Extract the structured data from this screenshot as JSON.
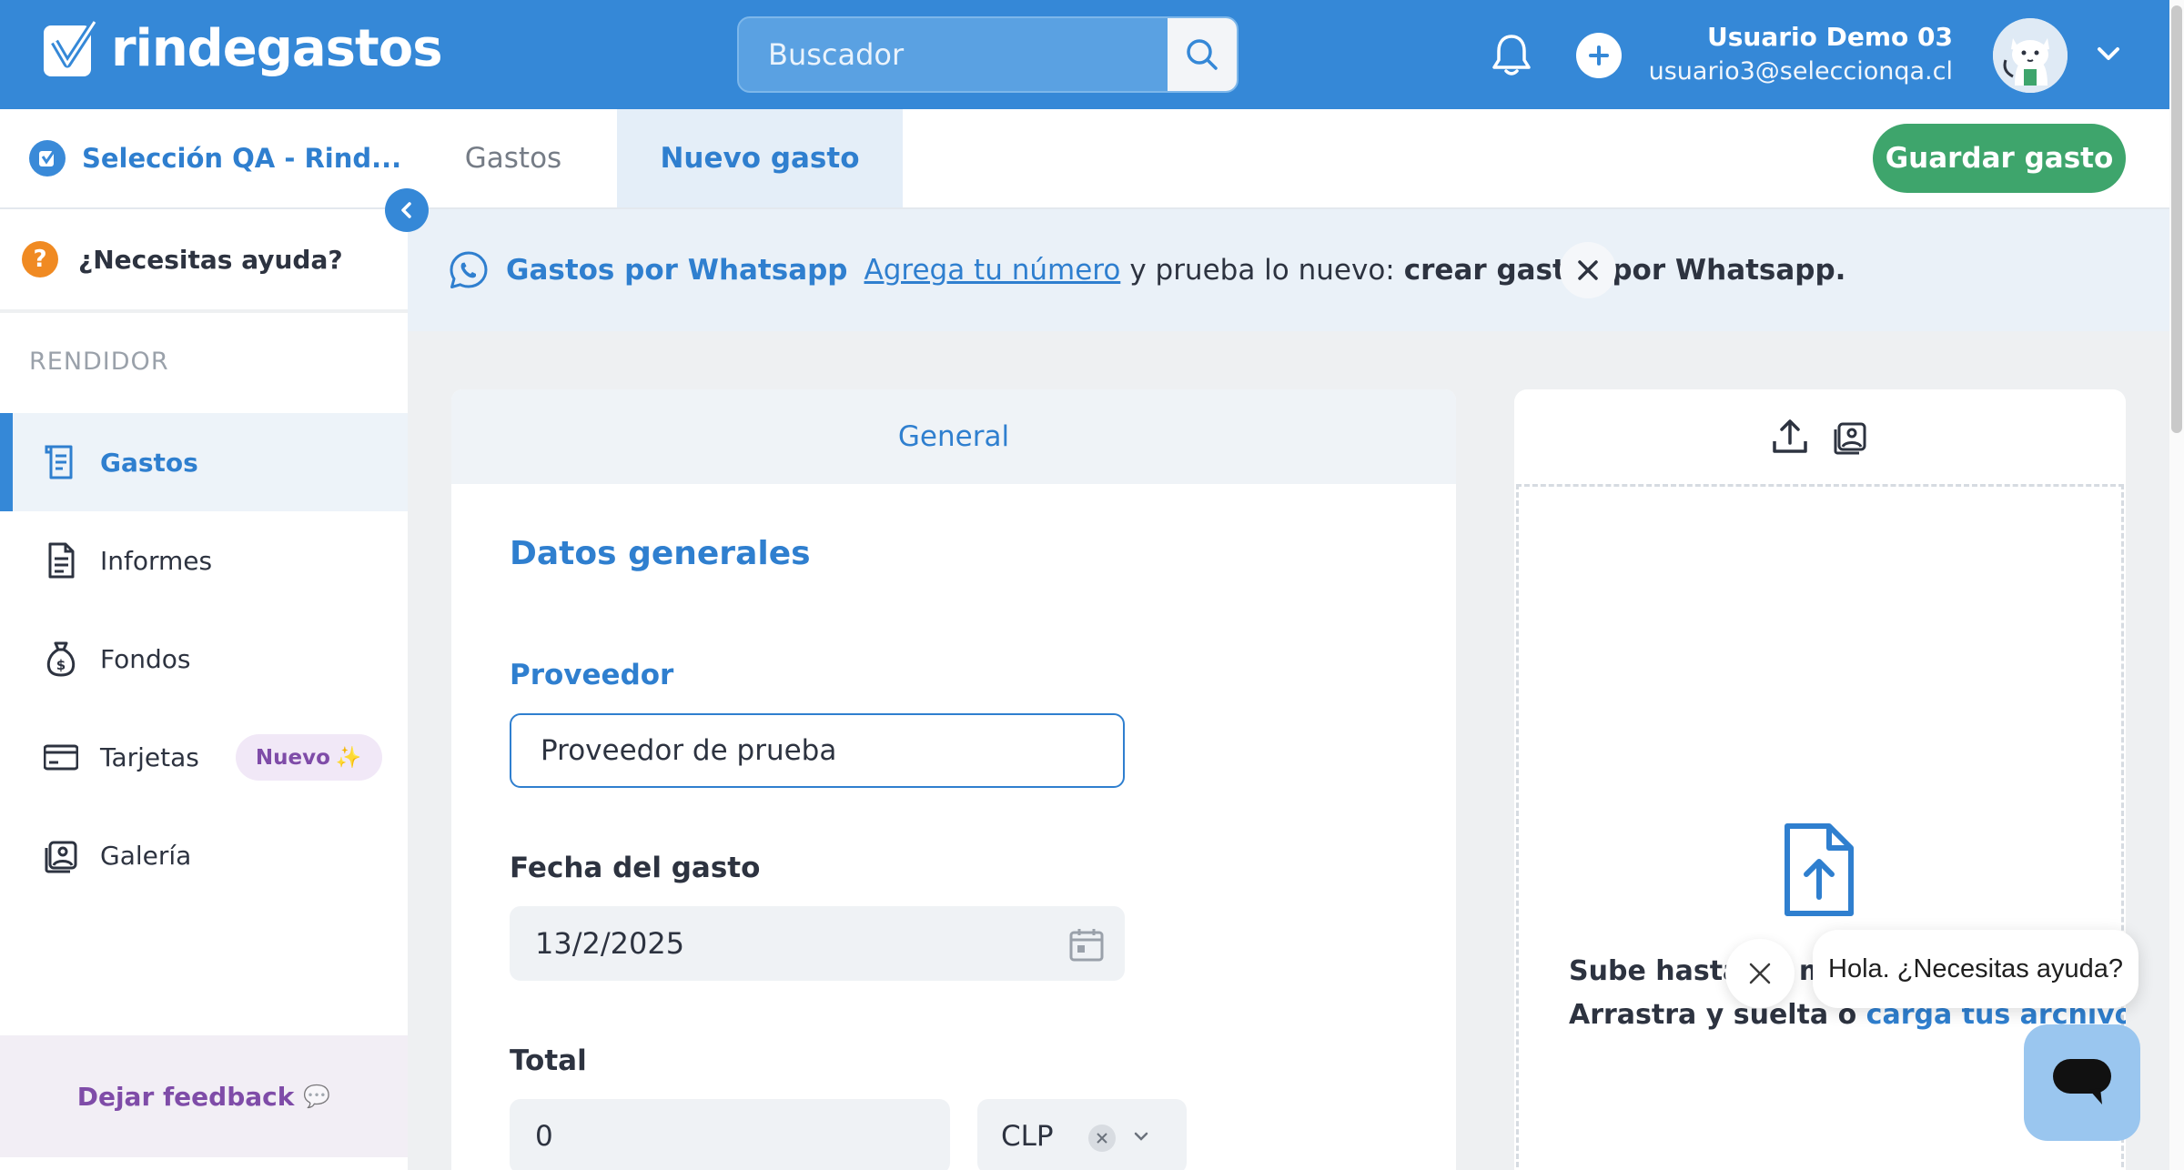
{
  "app": {
    "brand": "rindegastos",
    "colors": {
      "primary": "#3588d7",
      "success": "#3ea56c",
      "accent_purple": "#7f4ca8"
    }
  },
  "header": {
    "search_placeholder": "Buscador",
    "user_name": "Usuario Demo 03",
    "user_email": "usuario3@seleccionqa.cl",
    "icons": [
      "search-icon",
      "bell-icon",
      "plus-icon",
      "avatar",
      "chevron-down-icon"
    ]
  },
  "subbar": {
    "org_name": "Selección QA - Rind...",
    "tabs": [
      {
        "label": "Gastos",
        "active": false
      },
      {
        "label": "Nuevo gasto",
        "active": true
      }
    ],
    "save_label": "Guardar gasto"
  },
  "sidebar": {
    "help_label": "¿Necesitas ayuda?",
    "help_glyph": "?",
    "section_title": "RENDIDOR",
    "items": [
      {
        "label": "Gastos",
        "icon": "receipt-icon",
        "active": true
      },
      {
        "label": "Informes",
        "icon": "document-icon",
        "active": false
      },
      {
        "label": "Fondos",
        "icon": "money-bag-icon",
        "active": false
      },
      {
        "label": "Tarjetas",
        "icon": "card-icon",
        "active": false,
        "badge": "Nuevo",
        "badge_glyph": "✨"
      },
      {
        "label": "Galería",
        "icon": "gallery-icon",
        "active": false
      }
    ],
    "feedback_label": "Dejar feedback",
    "feedback_glyph": "💬"
  },
  "banner": {
    "title": "Gastos por Whatsapp",
    "link": "Agrega tu número",
    "text": "y prueba lo nuevo:",
    "strong": "crear gastos por Whatsapp."
  },
  "form": {
    "tab_label": "General",
    "heading": "Datos generales",
    "provider_label": "Proveedor",
    "provider_value": "Proveedor de prueba",
    "date_label": "Fecha del gasto",
    "date_value": "13/2/2025",
    "total_label": "Total",
    "total_value": "0",
    "currency_value": "CLP"
  },
  "upload": {
    "line1": "Sube hasta un má",
    "line2_text": "Arrastra y suelta o",
    "line2_link": "carga tus archivos"
  },
  "chat": {
    "greeting": "Hola. ¿Necesitas ayuda?"
  }
}
